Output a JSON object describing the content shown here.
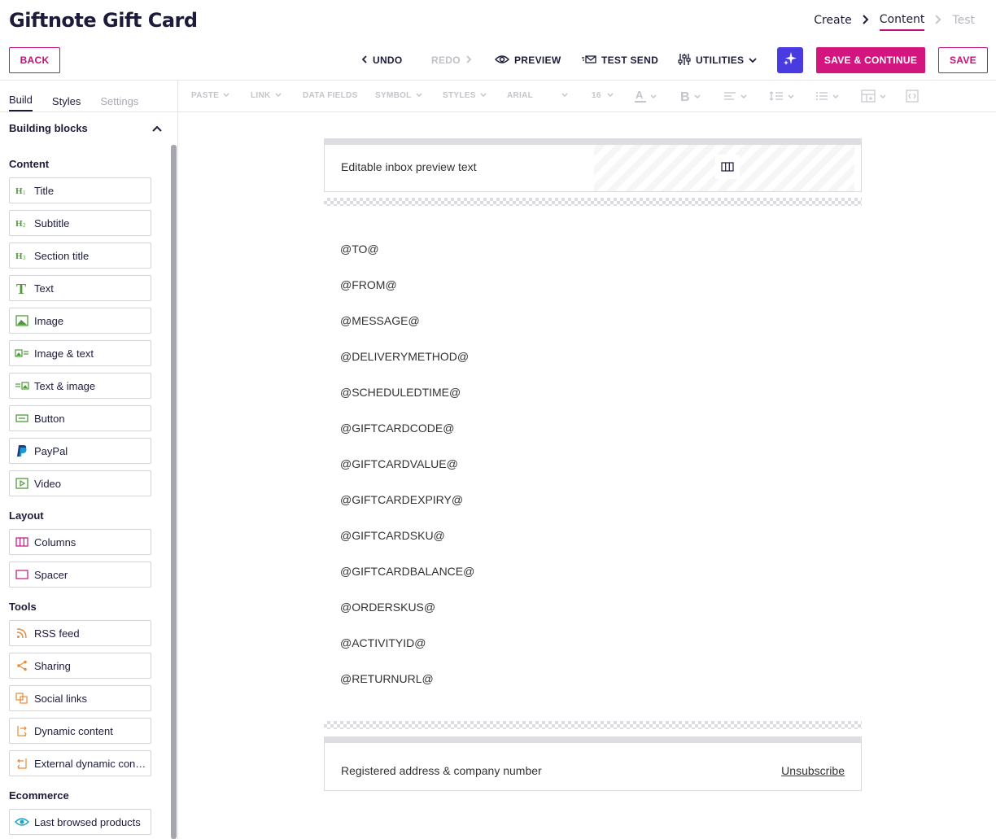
{
  "header": {
    "title": "Giftnote Gift Card",
    "steps": [
      {
        "label": "Create"
      },
      {
        "label": "Content"
      },
      {
        "label": "Test"
      }
    ]
  },
  "toolbar": {
    "back_label": "BACK",
    "undo_label": "UNDO",
    "redo_label": "REDO",
    "preview_label": "PREVIEW",
    "test_send_label": "TEST SEND",
    "utilities_label": "UTILITIES",
    "save_continue_label": "SAVE & CONTINUE",
    "save_label": "SAVE"
  },
  "left_panel": {
    "tabs": [
      "Build",
      "Styles",
      "Settings"
    ],
    "building_blocks_label": "Building blocks",
    "sections": {
      "content": {
        "label": "Content",
        "items": [
          "Title",
          "Subtitle",
          "Section title",
          "Text",
          "Image",
          "Image & text",
          "Text & image",
          "Button",
          "PayPal",
          "Video"
        ]
      },
      "layout": {
        "label": "Layout",
        "items": [
          "Columns",
          "Spacer"
        ]
      },
      "tools": {
        "label": "Tools",
        "items": [
          "RSS feed",
          "Sharing",
          "Social links",
          "Dynamic content",
          "External dynamic content"
        ]
      },
      "ecommerce": {
        "label": "Ecommerce",
        "items": [
          "Last browsed products"
        ]
      }
    }
  },
  "format_toolbar": {
    "paste": "PASTE",
    "link": "LINK",
    "data_fields": "DATA FIELDS",
    "symbol": "SYMBOL",
    "styles": "STYLES",
    "font": "ARIAL",
    "size": "16"
  },
  "canvas": {
    "preview_text": "Editable inbox preview text",
    "placeholders": [
      "@TO@",
      "@FROM@",
      "@MESSAGE@",
      "@DELIVERYMETHOD@",
      "@SCHEDULEDTIME@",
      "@GIFTCARDCODE@",
      "@GIFTCARDVALUE@",
      "@GIFTCARDEXPIRY@",
      "@GIFTCARDSKU@",
      "@GIFTCARDBALANCE@",
      "@ORDERSKUS@",
      "@ACTIVITYID@",
      "@RETURNURL@"
    ],
    "footer_address": "Registered address & company number",
    "footer_unsubscribe": "Unsubscribe"
  },
  "colors": {
    "brand": "#d4147f",
    "ai": "#4a3be0",
    "content_icons": "#4e9a3a",
    "layout_icons": "#c4117a",
    "tools_icons": "#e88a3a",
    "ecommerce_icons": "#1aa3c8"
  }
}
